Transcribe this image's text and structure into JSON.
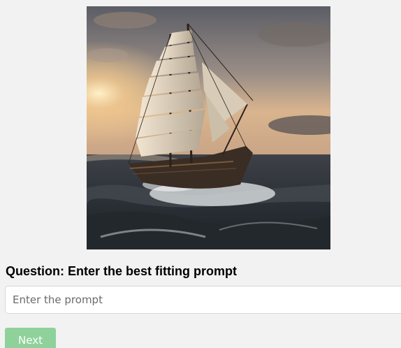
{
  "question": {
    "label": "Question: Enter the best fitting prompt"
  },
  "prompt": {
    "placeholder": "Enter the prompt",
    "value": ""
  },
  "next_button": {
    "label": "Next"
  },
  "colors": {
    "page_background": "#f2f2f2",
    "button_background": "#8fd19a",
    "button_text": "#ffffff"
  }
}
